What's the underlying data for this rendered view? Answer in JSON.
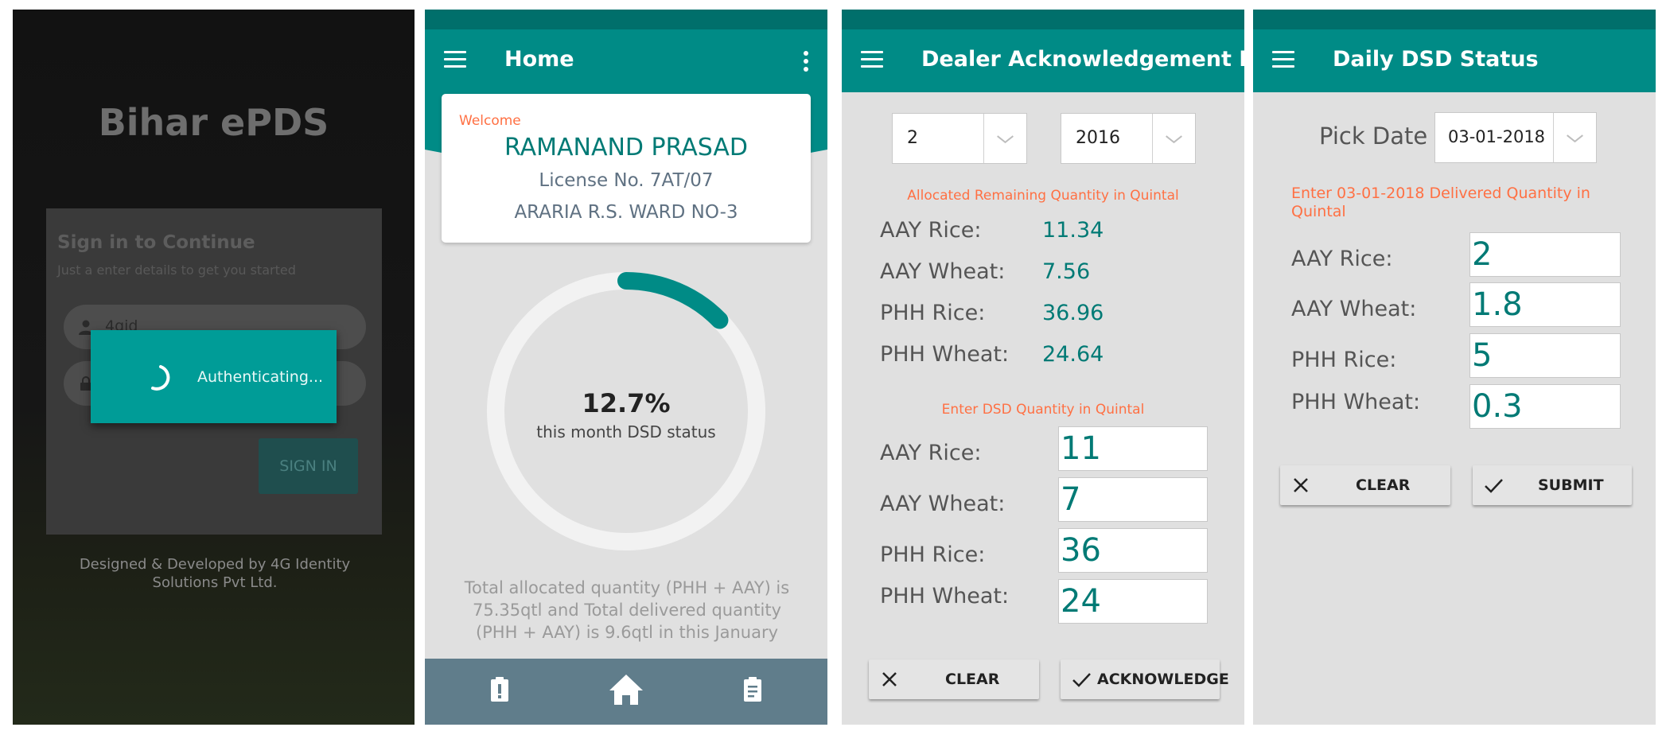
{
  "login": {
    "app_title": "Bihar ePDS",
    "card_title": "Sign in to Continue",
    "card_subtitle": "Just a enter details to get you started",
    "username_value": "4gid",
    "sign_in_label": "SIGN IN",
    "dialog_text": "Authenticating...",
    "footer": "Designed & Developed by 4G Identity Solutions Pvt Ltd."
  },
  "home": {
    "title": "Home",
    "welcome_label": "Welcome",
    "dealer_name": "RAMANAND PRASAD",
    "license": "License No. 7AT/07",
    "address": "ARARIA R.S. WARD NO-3",
    "progress_percent": 12.7,
    "progress_text": "12.7%",
    "progress_label": "this month DSD status",
    "summary": "Total allocated quantity (PHH + AAY) is 75.35qtl and Total delivered quantity (PHH + AAY) is 9.6qtl in this January",
    "nav_icons": [
      "report-icon",
      "home-icon",
      "clipboard-icon"
    ]
  },
  "ack": {
    "title": "Dealer Acknowledgement For...",
    "month_value": "2",
    "year_value": "2016",
    "allocated_label": "Allocated Remaining Quantity in Quintal",
    "allocated": [
      {
        "label": "AAY Rice:",
        "value": "11.34"
      },
      {
        "label": "AAY Wheat:",
        "value": "7.56"
      },
      {
        "label": "PHH Rice:",
        "value": "36.96"
      },
      {
        "label": "PHH Wheat:",
        "value": "24.64"
      }
    ],
    "enter_label": "Enter DSD Quantity in Quintal",
    "entries": [
      {
        "label": "AAY Rice:",
        "value": "11"
      },
      {
        "label": "AAY Wheat:",
        "value": "7"
      },
      {
        "label": "PHH Rice:",
        "value": "36"
      },
      {
        "label": "PHH Wheat:",
        "value": "24"
      }
    ],
    "clear_label": "CLEAR",
    "acknowledge_label": "ACKNOWLEDGE"
  },
  "dsd": {
    "title": "Daily DSD Status",
    "pick_date_label": "Pick Date",
    "date_value": "03-01-2018",
    "enter_label": "Enter 03-01-2018 Delivered Quantity in Quintal",
    "entries": [
      {
        "label": "AAY Rice:",
        "value": "2"
      },
      {
        "label": "AAY Wheat:",
        "value": "1.8"
      },
      {
        "label": "PHH Rice:",
        "value": "5"
      },
      {
        "label": "PHH Wheat:",
        "value": "0.3"
      }
    ],
    "clear_label": "CLEAR",
    "submit_label": "SUBMIT"
  },
  "colors": {
    "primary": "#008b86",
    "primary_dark": "#006f6b",
    "accent_orange": "#ff7043",
    "bottom_nav": "#607d8b"
  }
}
